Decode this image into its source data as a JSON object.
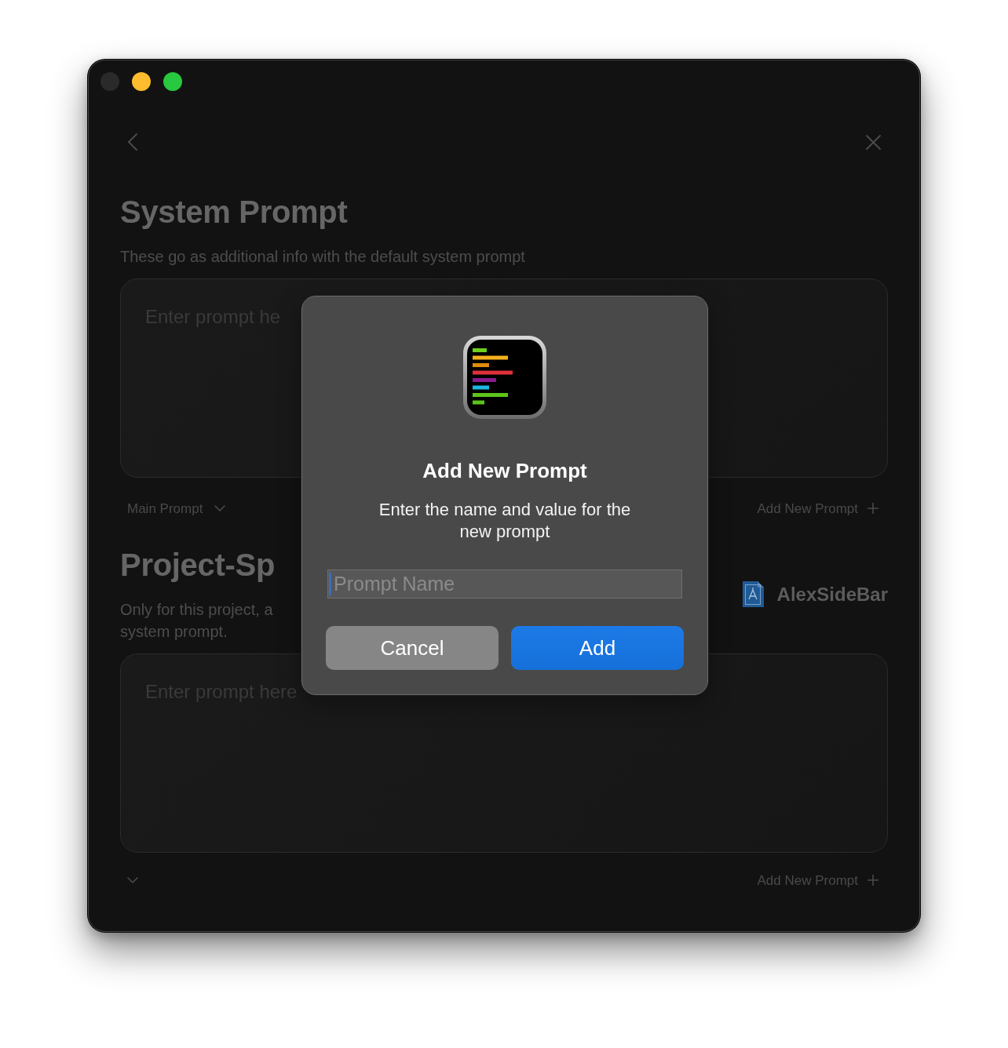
{
  "window": {
    "controls": [
      {
        "kind": "close",
        "disabled": true
      },
      {
        "kind": "minimize",
        "disabled": false
      },
      {
        "kind": "zoom",
        "disabled": false
      }
    ]
  },
  "sections": [
    {
      "title": "System Prompt",
      "description_lines": [
        "These go as additional info with the default system prompt"
      ],
      "editor": {
        "placeholder": "Enter prompt he"
      },
      "selector": {
        "label": "Main Prompt"
      },
      "add_button": {
        "label": "Add New Prompt"
      }
    },
    {
      "title": "Project-Sp",
      "description_lines": [
        "Only for this project, a",
        "system prompt."
      ],
      "project": {
        "name": "AlexSideBar"
      },
      "editor": {
        "placeholder": "Enter prompt here"
      },
      "add_button": {
        "label": "Add New Prompt"
      }
    }
  ],
  "dialog": {
    "title": "Add New Prompt",
    "message": "Enter the name and value for the new prompt",
    "field": {
      "placeholder": "Prompt Name",
      "focused": true
    },
    "buttons": [
      {
        "label": "Cancel",
        "kind": "secondary"
      },
      {
        "label": "Add",
        "kind": "primary"
      }
    ]
  }
}
